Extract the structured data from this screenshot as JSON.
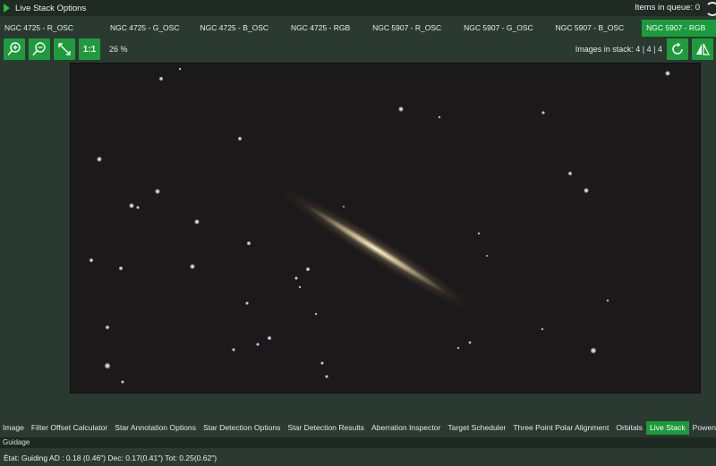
{
  "header": {
    "title": "Live Stack Options",
    "queue": "Items in queue: 0"
  },
  "tabs": [
    "NGC 4725 - R_OSC",
    "NGC 4725 - G_OSC",
    "NGC 4725 - B_OSC",
    "NGC 4725 - RGB",
    "NGC 5907 - R_OSC",
    "NGC 5907 - G_OSC",
    "NGC 5907 - B_OSC",
    "NGC 5907 - RGB"
  ],
  "active_tab": "NGC 5907 - RGB",
  "toolbar": {
    "zoom_in": "zoom-in-icon",
    "zoom_out": "zoom-out-icon",
    "fit": "fit-to-window-icon",
    "one_to_one": "1:1",
    "zoom_level": "26 %",
    "images_in_stack": "Images in stack: 4 | 4 | 4"
  },
  "bottom_tabs": [
    "Image",
    "Filter Offset Calculator",
    "Star Annotation Options",
    "Star Detection Options",
    "Star Detection Results",
    "Aberration Inspector",
    "Target Scheduler",
    "Three Point Polar Alignment",
    "Orbitals",
    "Live Stack",
    "Powerups P"
  ],
  "active_bottom_tab": "Live Stack",
  "guiding": {
    "section_label": "Guidage",
    "status": "État: Guiding  AD : 0.18 (0.46\")  Dec: 0.17(0.41\")  Tot: 0.25(0.62\")"
  },
  "colors": {
    "accent": "#1c9b3c",
    "background": "#2b3a30",
    "image_bg": "#1b1919"
  }
}
